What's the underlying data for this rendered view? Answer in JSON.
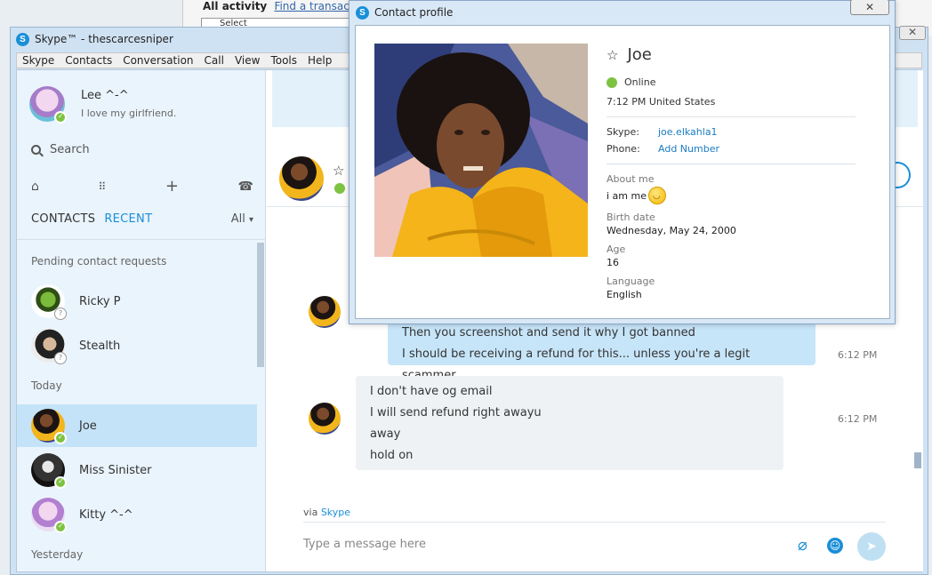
{
  "background": {
    "text": "All activity",
    "link": "Find a transaction",
    "select": "Select"
  },
  "skype": {
    "title": "Skype™ - thescarcesniper",
    "close": "✕",
    "menu": [
      "Skype",
      "Contacts",
      "Conversation",
      "Call",
      "View",
      "Tools",
      "Help"
    ],
    "me": {
      "name": "Lee ^-^",
      "mood": "I love my girlfriend."
    },
    "search_placeholder": "Search",
    "tabs": {
      "contacts": "CONTACTS",
      "recent": "RECENT",
      "filter": "All"
    },
    "sections": {
      "pending": "Pending contact requests",
      "today": "Today",
      "yesterday": "Yesterday"
    },
    "contacts": [
      {
        "name": "Ricky P"
      },
      {
        "name": "Stealth"
      },
      {
        "name": "Joe"
      },
      {
        "name": "Miss Sinister"
      },
      {
        "name": "Kitty ^-^"
      }
    ]
  },
  "conversation": {
    "outgoing": [
      "Then you screenshot and send it why I got banned",
      "I should be receiving a refund for this... unless you're a legit scammer"
    ],
    "outgoing_time": "6:12 PM",
    "incoming": [
      "I don't have og email",
      "I will send refund right awayu",
      "away",
      "hold on"
    ],
    "incoming_time": "6:12 PM",
    "via": "via",
    "via_link": "Skype",
    "compose_placeholder": "Type a message here"
  },
  "profile": {
    "window_title": "Contact profile",
    "close": "✕",
    "name": "Joe",
    "status": "Online",
    "local_time": "7:12 PM United States",
    "skype_label": "Skype:",
    "skype_value": "joe.elkahla1",
    "phone_label": "Phone:",
    "phone_value": "Add Number",
    "about_label": "About me",
    "about_value": "i am me",
    "birth_label": "Birth date",
    "birth_value": "Wednesday, May 24, 2000",
    "age_label": "Age",
    "age_value": "16",
    "language_label": "Language",
    "language_value": "English"
  },
  "colors": {
    "accent": "#1a8fd8",
    "online": "#7ec242",
    "selected": "#c4e3f8",
    "outgoing_bubble": "#c7e5f9"
  }
}
